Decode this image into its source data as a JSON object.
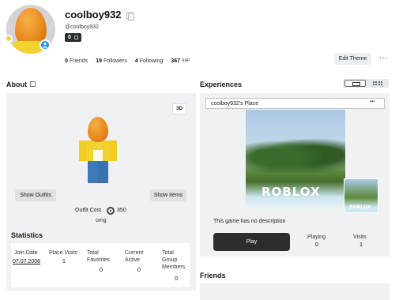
{
  "profile": {
    "display_name": "coolboy932",
    "username": "@coolboy932",
    "robux_badge": "0",
    "stats": {
      "friends_count": "0",
      "friends_label": "Friends",
      "followers_count": "19",
      "followers_label": "Followers",
      "following_count": "4",
      "following_label": "Following",
      "rap_value": "367",
      "rap_label": "RAP"
    },
    "edit_theme_label": "Edit Theme",
    "more_label": "···"
  },
  "about": {
    "title": "About",
    "view_3d_label": "3D",
    "show_outfits_label": "Show Outfits",
    "show_items_label": "Show Items",
    "outfit_cost_label": "Outfit Cost",
    "outfit_cost_value": "350",
    "outfit_name": "omg"
  },
  "statistics": {
    "title": "Statistics",
    "columns": [
      {
        "label": "Join Date",
        "value": "07.07.2008"
      },
      {
        "label": "Place Visits",
        "value": "1"
      },
      {
        "label": "Total Favorites",
        "value": "0"
      },
      {
        "label": "Current Active",
        "value": "0"
      },
      {
        "label": "Total Group Members",
        "value": "0"
      }
    ]
  },
  "experiences": {
    "title": "Experiences",
    "place_name": "coolboy932's Place",
    "place_menu_label": "▪▪▪",
    "thumbnail_logo": "ROBLOX",
    "description": "This game has no description",
    "play_label": "Play",
    "playing_label": "Playing",
    "playing_value": "0",
    "visits_label": "Visits",
    "visits_value": "1"
  },
  "friends": {
    "title": "Friends"
  },
  "colors": {
    "panel_bg": "#f0f1f2",
    "dark_button": "#2b2d30",
    "status_blue": "#1e8ef0",
    "avatar_egg": "#e88a1e",
    "avatar_torso": "#f2d22e"
  }
}
